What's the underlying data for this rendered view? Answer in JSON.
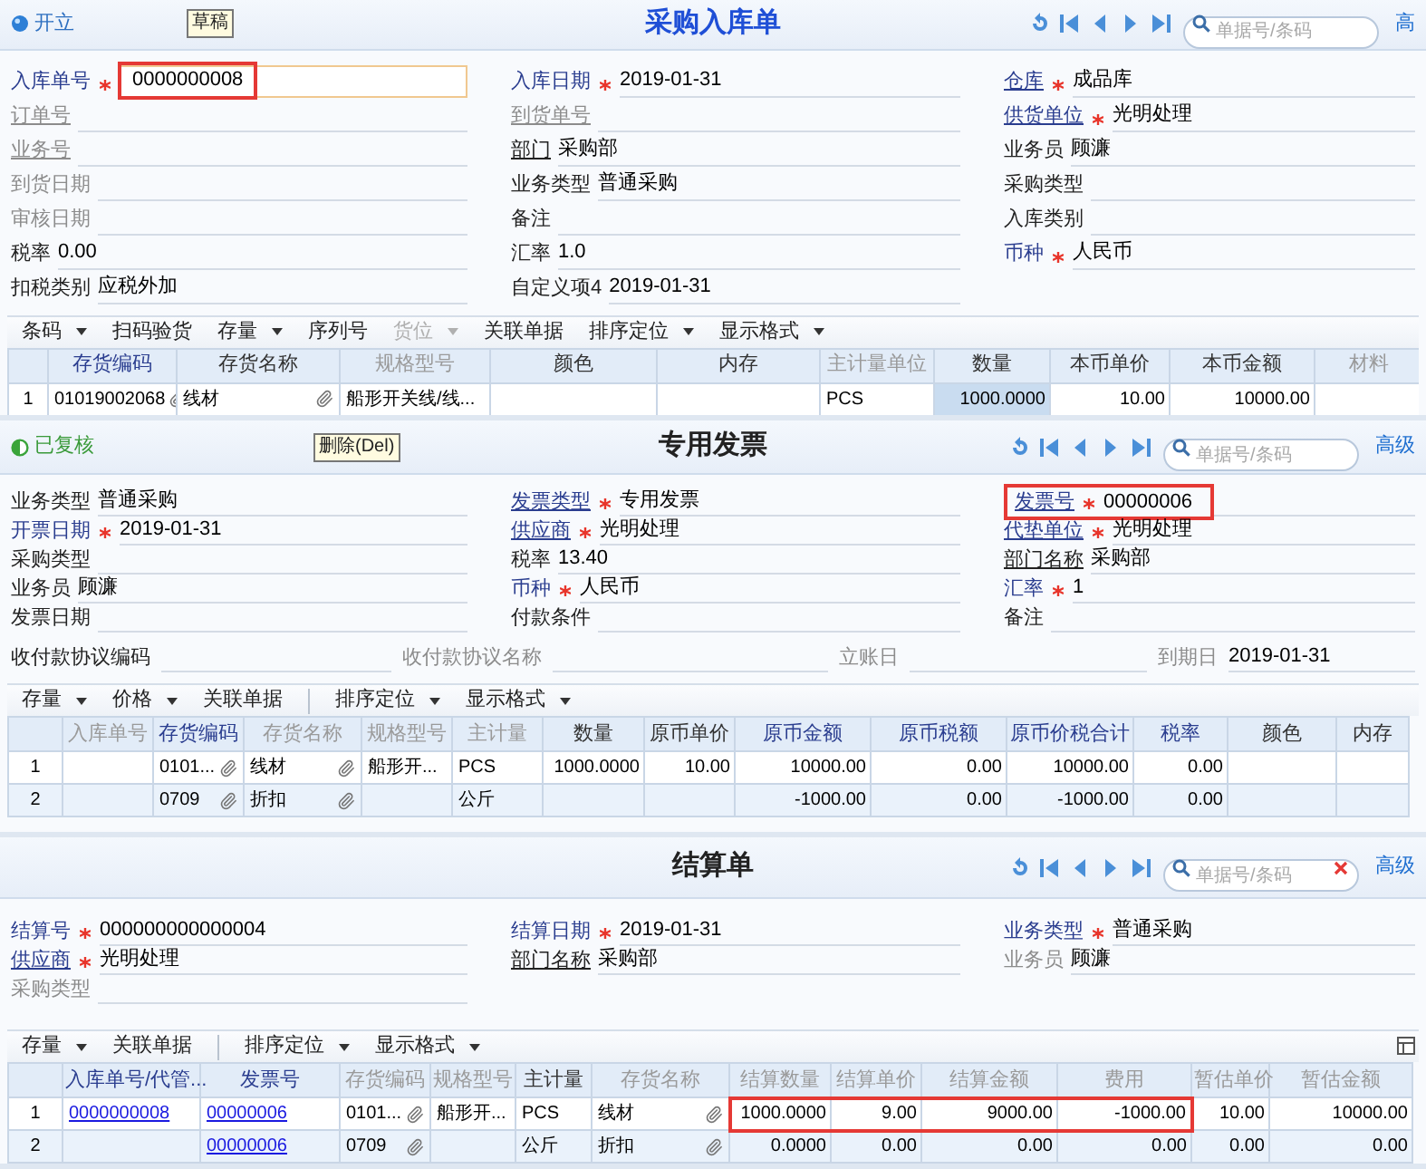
{
  "panels": [
    {
      "status": {
        "label": "开立",
        "kind": "open"
      },
      "tooltip": "草稿",
      "title": "采购入库单",
      "search": {
        "placeholder": "单据号/条码",
        "clearable": false
      },
      "advanced": "高",
      "field_columns": [
        [
          {
            "label": "入库单号",
            "kind": "blue",
            "required": true,
            "value": "0000000008",
            "focused": true,
            "outlined": true
          },
          {
            "label": "订单号",
            "kind": "muted-link",
            "required": false
          },
          {
            "label": "业务号",
            "kind": "muted-link",
            "required": false
          },
          {
            "label": "到货日期",
            "kind": "muted",
            "required": false
          },
          {
            "label": "审核日期",
            "kind": "muted",
            "required": false
          },
          {
            "label": "税率",
            "kind": "plain",
            "required": false,
            "value": "0.00"
          },
          {
            "label": "扣税类别",
            "kind": "plain",
            "required": false,
            "value": "应税外加"
          }
        ],
        [
          {
            "label": "入库日期",
            "kind": "blue",
            "required": true,
            "value": "2019-01-31"
          },
          {
            "label": "到货单号",
            "kind": "muted-link",
            "required": false
          },
          {
            "label": "部门",
            "kind": "underline",
            "required": false,
            "value": "采购部"
          },
          {
            "label": "业务类型",
            "kind": "plain",
            "required": false,
            "value": "普通采购"
          },
          {
            "label": "备注",
            "kind": "plain",
            "required": false
          },
          {
            "label": "汇率",
            "kind": "plain",
            "required": false,
            "value": "1.0"
          },
          {
            "label": "自定义项4",
            "kind": "plain",
            "required": false,
            "value": "2019-01-31"
          }
        ],
        [
          {
            "label": "仓库",
            "kind": "link",
            "required": true,
            "value": "成品库"
          },
          {
            "label": "供货单位",
            "kind": "link",
            "required": true,
            "value": "光明处理"
          },
          {
            "label": "业务员",
            "kind": "plain",
            "required": false,
            "value": "顾濂"
          },
          {
            "label": "采购类型",
            "kind": "plain",
            "required": false
          },
          {
            "label": "入库类别",
            "kind": "plain",
            "required": false
          },
          {
            "label": "币种",
            "kind": "blue",
            "required": true,
            "value": "人民币"
          }
        ]
      ],
      "toolbar": {
        "items": [
          {
            "label": "条码",
            "dropdown": true,
            "disabled": false
          },
          {
            "label": "扫码验货",
            "dropdown": false,
            "disabled": false
          },
          {
            "label": "存量",
            "dropdown": true,
            "disabled": false
          },
          {
            "label": "序列号",
            "dropdown": false,
            "disabled": false
          },
          {
            "label": "货位",
            "dropdown": true,
            "disabled": true
          },
          {
            "label": "关联单据",
            "dropdown": false,
            "disabled": false
          },
          {
            "label": "排序定位",
            "dropdown": true,
            "disabled": false
          },
          {
            "label": "显示格式",
            "dropdown": true,
            "disabled": false
          }
        ]
      },
      "table": {
        "columns": [
          {
            "label": "存货编码",
            "emphasized": true,
            "disabled": false,
            "kind": "clip"
          },
          {
            "label": "存货名称",
            "emphasized": false,
            "disabled": false,
            "kind": "clip"
          },
          {
            "label": "规格型号",
            "emphasized": false,
            "disabled": true,
            "kind": "text"
          },
          {
            "label": "颜色",
            "emphasized": false,
            "disabled": false,
            "kind": "text"
          },
          {
            "label": "内存",
            "emphasized": false,
            "disabled": false,
            "kind": "text"
          },
          {
            "label": "主计量单位",
            "emphasized": false,
            "disabled": true,
            "kind": "text"
          },
          {
            "label": "数量",
            "emphasized": false,
            "disabled": false,
            "kind": "number",
            "shaded": true
          },
          {
            "label": "本币单价",
            "emphasized": false,
            "disabled": false,
            "kind": "number"
          },
          {
            "label": "本币金额",
            "emphasized": false,
            "disabled": false,
            "kind": "number"
          },
          {
            "label": "材料",
            "emphasized": false,
            "disabled": true,
            "kind": "text"
          }
        ],
        "rows": [
          {
            "number": "1",
            "cells": [
              "01019002068",
              "线材",
              "船形开关线/线...",
              null,
              null,
              "PCS",
              "1000.0000",
              "10.00",
              "10000.00",
              null
            ]
          }
        ]
      }
    },
    {
      "status": {
        "label": "已复核",
        "kind": "approved"
      },
      "tooltip": "删除(Del)",
      "title": "专用发票",
      "search": {
        "placeholder": "单据号/条码",
        "clearable": false
      },
      "advanced": "高级",
      "field_columns": [
        [
          {
            "label": "业务类型",
            "kind": "plain",
            "required": false,
            "value": "普通采购"
          },
          {
            "label": "开票日期",
            "kind": "blue",
            "required": true,
            "value": "2019-01-31"
          },
          {
            "label": "采购类型",
            "kind": "plain",
            "required": false
          },
          {
            "label": "业务员",
            "kind": "plain",
            "required": false,
            "value": "顾濂"
          },
          {
            "label": "发票日期",
            "kind": "plain",
            "required": false
          }
        ],
        [
          {
            "label": "发票类型",
            "kind": "link",
            "required": true,
            "value": "专用发票"
          },
          {
            "label": "供应商",
            "kind": "link",
            "required": true,
            "value": "光明处理"
          },
          {
            "label": "税率",
            "kind": "plain",
            "required": false,
            "value": "13.40"
          },
          {
            "label": "币种",
            "kind": "blue",
            "required": true,
            "value": "人民币"
          },
          {
            "label": "付款条件",
            "kind": "plain",
            "required": false
          }
        ],
        [
          {
            "label": "发票号",
            "kind": "link",
            "required": true,
            "value": "00000006",
            "outlined": true
          },
          {
            "label": "代垫单位",
            "kind": "link",
            "required": true,
            "value": "光明处理"
          },
          {
            "label": "部门名称",
            "kind": "underline",
            "required": false,
            "value": "采购部"
          },
          {
            "label": "汇率",
            "kind": "blue",
            "required": true,
            "value": "1"
          },
          {
            "label": "备注",
            "kind": "plain",
            "required": false
          }
        ]
      ],
      "extra_row": [
        {
          "label": "收付款协议编码",
          "kind": "plain"
        },
        {
          "label": "收付款协议名称",
          "kind": "muted"
        },
        {
          "label": "立账日",
          "kind": "muted"
        },
        {
          "label": "到期日",
          "kind": "muted",
          "value": "2019-01-31"
        }
      ],
      "toolbar": {
        "items": [
          {
            "label": "存量",
            "dropdown": true,
            "disabled": false
          },
          {
            "label": "价格",
            "dropdown": true,
            "disabled": false
          },
          {
            "label": "关联单据",
            "dropdown": false,
            "disabled": false
          },
          {
            "label": "排序定位",
            "dropdown": true,
            "disabled": false,
            "separator_before": true
          },
          {
            "label": "显示格式",
            "dropdown": true,
            "disabled": false
          }
        ]
      },
      "table": {
        "columns": [
          {
            "label": "入库单号",
            "emphasized": false,
            "disabled": true,
            "kind": "text"
          },
          {
            "label": "存货编码",
            "emphasized": true,
            "disabled": false,
            "kind": "clip"
          },
          {
            "label": "存货名称",
            "emphasized": false,
            "disabled": true,
            "kind": "clip"
          },
          {
            "label": "规格型号",
            "emphasized": false,
            "disabled": true,
            "kind": "text"
          },
          {
            "label": "主计量",
            "emphasized": false,
            "disabled": true,
            "kind": "text"
          },
          {
            "label": "数量",
            "emphasized": false,
            "disabled": false,
            "kind": "number"
          },
          {
            "label": "原币单价",
            "emphasized": false,
            "disabled": false,
            "kind": "number"
          },
          {
            "label": "原币金额",
            "emphasized": true,
            "disabled": false,
            "kind": "number"
          },
          {
            "label": "原币税额",
            "emphasized": true,
            "disabled": false,
            "kind": "number"
          },
          {
            "label": "原币价税合计",
            "emphasized": true,
            "disabled": false,
            "kind": "number"
          },
          {
            "label": "税率",
            "emphasized": true,
            "disabled": false,
            "kind": "number"
          },
          {
            "label": "颜色",
            "emphasized": false,
            "disabled": false,
            "kind": "text"
          },
          {
            "label": "内存",
            "emphasized": false,
            "disabled": false,
            "kind": "text"
          }
        ],
        "rows": [
          {
            "number": "1",
            "cells": [
              null,
              "0101...",
              "线材",
              "船形开...",
              "PCS",
              "1000.0000",
              "10.00",
              "10000.00",
              "0.00",
              "10000.00",
              "0.00",
              null,
              null
            ]
          },
          {
            "number": "2",
            "cells": [
              null,
              "0709",
              "折扣",
              null,
              "公斤",
              null,
              null,
              "-1000.00",
              "0.00",
              "-1000.00",
              "0.00",
              null,
              null
            ]
          }
        ]
      }
    },
    {
      "title": "结算单",
      "search": {
        "placeholder": "单据号/条码",
        "clearable": true
      },
      "advanced": "高级",
      "field_columns": [
        [
          {
            "label": "结算号",
            "kind": "blue",
            "required": true,
            "value": "000000000000004"
          },
          {
            "label": "供应商",
            "kind": "link",
            "required": true,
            "value": "光明处理"
          },
          {
            "label": "采购类型",
            "kind": "muted",
            "required": false
          }
        ],
        [
          {
            "label": "结算日期",
            "kind": "blue",
            "required": true,
            "value": "2019-01-31"
          },
          {
            "label": "部门名称",
            "kind": "underline",
            "required": false,
            "value": "采购部"
          }
        ],
        [
          {
            "label": "业务类型",
            "kind": "blue",
            "required": true,
            "value": "普通采购"
          },
          {
            "label": "业务员",
            "kind": "muted",
            "required": false,
            "value": "顾濂"
          }
        ]
      ],
      "toolbar": {
        "layout_icon": true,
        "items": [
          {
            "label": "存量",
            "dropdown": true,
            "disabled": false
          },
          {
            "label": "关联单据",
            "dropdown": false,
            "disabled": false
          },
          {
            "label": "排序定位",
            "dropdown": true,
            "disabled": false,
            "separator_before": true
          },
          {
            "label": "显示格式",
            "dropdown": true,
            "disabled": false
          }
        ]
      },
      "table": {
        "columns": [
          {
            "label": "入库单号/代管...",
            "emphasized": true,
            "disabled": false,
            "kind": "link"
          },
          {
            "label": "发票号",
            "emphasized": true,
            "disabled": false,
            "kind": "link"
          },
          {
            "label": "存货编码",
            "emphasized": false,
            "disabled": true,
            "kind": "clip"
          },
          {
            "label": "规格型号",
            "emphasized": false,
            "disabled": true,
            "kind": "text"
          },
          {
            "label": "主计量",
            "emphasized": false,
            "disabled": false,
            "kind": "text"
          },
          {
            "label": "存货名称",
            "emphasized": false,
            "disabled": true,
            "kind": "clip"
          },
          {
            "label": "结算数量",
            "emphasized": false,
            "disabled": true,
            "kind": "number",
            "outlined": true
          },
          {
            "label": "结算单价",
            "emphasized": false,
            "disabled": true,
            "kind": "number",
            "outlined": true
          },
          {
            "label": "结算金额",
            "emphasized": false,
            "disabled": true,
            "kind": "number",
            "outlined": true
          },
          {
            "label": "费用",
            "emphasized": false,
            "disabled": true,
            "kind": "number",
            "outlined": true
          },
          {
            "label": "暂估单价",
            "emphasized": false,
            "disabled": true,
            "kind": "number"
          },
          {
            "label": "暂估金额",
            "emphasized": false,
            "disabled": true,
            "kind": "number"
          }
        ],
        "rows": [
          {
            "number": "1",
            "outlined": true,
            "cells": [
              "0000000008",
              "00000006",
              "0101...",
              "船形开...",
              "PCS",
              "线材",
              "1000.0000",
              "9.00",
              "9000.00",
              "-1000.00",
              "10.00",
              "10000.00"
            ]
          },
          {
            "number": "2",
            "cells": [
              null,
              "00000006",
              "0709",
              null,
              "公斤",
              "折扣",
              "0.0000",
              "0.00",
              "0.00",
              "0.00",
              "0.00",
              "0.00"
            ]
          }
        ]
      }
    }
  ]
}
